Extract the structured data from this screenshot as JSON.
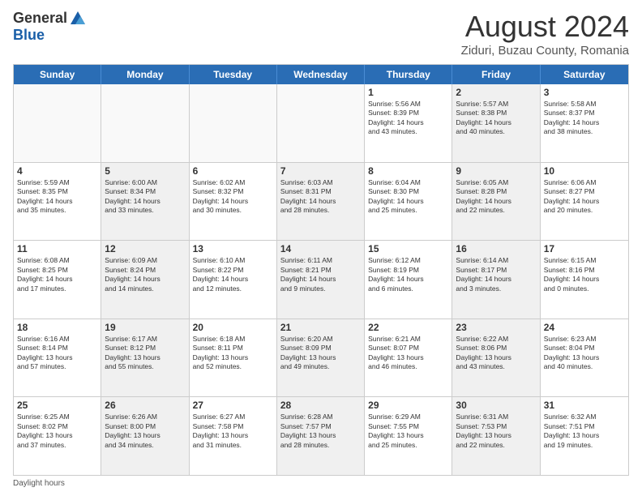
{
  "header": {
    "logo_general": "General",
    "logo_blue": "Blue",
    "month_year": "August 2024",
    "location": "Ziduri, Buzau County, Romania"
  },
  "days_of_week": [
    "Sunday",
    "Monday",
    "Tuesday",
    "Wednesday",
    "Thursday",
    "Friday",
    "Saturday"
  ],
  "weeks": [
    [
      {
        "num": "",
        "info": "",
        "shaded": false,
        "empty": true
      },
      {
        "num": "",
        "info": "",
        "shaded": false,
        "empty": true
      },
      {
        "num": "",
        "info": "",
        "shaded": false,
        "empty": true
      },
      {
        "num": "",
        "info": "",
        "shaded": false,
        "empty": true
      },
      {
        "num": "1",
        "info": "Sunrise: 5:56 AM\nSunset: 8:39 PM\nDaylight: 14 hours\nand 43 minutes.",
        "shaded": false,
        "empty": false
      },
      {
        "num": "2",
        "info": "Sunrise: 5:57 AM\nSunset: 8:38 PM\nDaylight: 14 hours\nand 40 minutes.",
        "shaded": true,
        "empty": false
      },
      {
        "num": "3",
        "info": "Sunrise: 5:58 AM\nSunset: 8:37 PM\nDaylight: 14 hours\nand 38 minutes.",
        "shaded": false,
        "empty": false
      }
    ],
    [
      {
        "num": "4",
        "info": "Sunrise: 5:59 AM\nSunset: 8:35 PM\nDaylight: 14 hours\nand 35 minutes.",
        "shaded": false,
        "empty": false
      },
      {
        "num": "5",
        "info": "Sunrise: 6:00 AM\nSunset: 8:34 PM\nDaylight: 14 hours\nand 33 minutes.",
        "shaded": true,
        "empty": false
      },
      {
        "num": "6",
        "info": "Sunrise: 6:02 AM\nSunset: 8:32 PM\nDaylight: 14 hours\nand 30 minutes.",
        "shaded": false,
        "empty": false
      },
      {
        "num": "7",
        "info": "Sunrise: 6:03 AM\nSunset: 8:31 PM\nDaylight: 14 hours\nand 28 minutes.",
        "shaded": true,
        "empty": false
      },
      {
        "num": "8",
        "info": "Sunrise: 6:04 AM\nSunset: 8:30 PM\nDaylight: 14 hours\nand 25 minutes.",
        "shaded": false,
        "empty": false
      },
      {
        "num": "9",
        "info": "Sunrise: 6:05 AM\nSunset: 8:28 PM\nDaylight: 14 hours\nand 22 minutes.",
        "shaded": true,
        "empty": false
      },
      {
        "num": "10",
        "info": "Sunrise: 6:06 AM\nSunset: 8:27 PM\nDaylight: 14 hours\nand 20 minutes.",
        "shaded": false,
        "empty": false
      }
    ],
    [
      {
        "num": "11",
        "info": "Sunrise: 6:08 AM\nSunset: 8:25 PM\nDaylight: 14 hours\nand 17 minutes.",
        "shaded": false,
        "empty": false
      },
      {
        "num": "12",
        "info": "Sunrise: 6:09 AM\nSunset: 8:24 PM\nDaylight: 14 hours\nand 14 minutes.",
        "shaded": true,
        "empty": false
      },
      {
        "num": "13",
        "info": "Sunrise: 6:10 AM\nSunset: 8:22 PM\nDaylight: 14 hours\nand 12 minutes.",
        "shaded": false,
        "empty": false
      },
      {
        "num": "14",
        "info": "Sunrise: 6:11 AM\nSunset: 8:21 PM\nDaylight: 14 hours\nand 9 minutes.",
        "shaded": true,
        "empty": false
      },
      {
        "num": "15",
        "info": "Sunrise: 6:12 AM\nSunset: 8:19 PM\nDaylight: 14 hours\nand 6 minutes.",
        "shaded": false,
        "empty": false
      },
      {
        "num": "16",
        "info": "Sunrise: 6:14 AM\nSunset: 8:17 PM\nDaylight: 14 hours\nand 3 minutes.",
        "shaded": true,
        "empty": false
      },
      {
        "num": "17",
        "info": "Sunrise: 6:15 AM\nSunset: 8:16 PM\nDaylight: 14 hours\nand 0 minutes.",
        "shaded": false,
        "empty": false
      }
    ],
    [
      {
        "num": "18",
        "info": "Sunrise: 6:16 AM\nSunset: 8:14 PM\nDaylight: 13 hours\nand 57 minutes.",
        "shaded": false,
        "empty": false
      },
      {
        "num": "19",
        "info": "Sunrise: 6:17 AM\nSunset: 8:12 PM\nDaylight: 13 hours\nand 55 minutes.",
        "shaded": true,
        "empty": false
      },
      {
        "num": "20",
        "info": "Sunrise: 6:18 AM\nSunset: 8:11 PM\nDaylight: 13 hours\nand 52 minutes.",
        "shaded": false,
        "empty": false
      },
      {
        "num": "21",
        "info": "Sunrise: 6:20 AM\nSunset: 8:09 PM\nDaylight: 13 hours\nand 49 minutes.",
        "shaded": true,
        "empty": false
      },
      {
        "num": "22",
        "info": "Sunrise: 6:21 AM\nSunset: 8:07 PM\nDaylight: 13 hours\nand 46 minutes.",
        "shaded": false,
        "empty": false
      },
      {
        "num": "23",
        "info": "Sunrise: 6:22 AM\nSunset: 8:06 PM\nDaylight: 13 hours\nand 43 minutes.",
        "shaded": true,
        "empty": false
      },
      {
        "num": "24",
        "info": "Sunrise: 6:23 AM\nSunset: 8:04 PM\nDaylight: 13 hours\nand 40 minutes.",
        "shaded": false,
        "empty": false
      }
    ],
    [
      {
        "num": "25",
        "info": "Sunrise: 6:25 AM\nSunset: 8:02 PM\nDaylight: 13 hours\nand 37 minutes.",
        "shaded": false,
        "empty": false
      },
      {
        "num": "26",
        "info": "Sunrise: 6:26 AM\nSunset: 8:00 PM\nDaylight: 13 hours\nand 34 minutes.",
        "shaded": true,
        "empty": false
      },
      {
        "num": "27",
        "info": "Sunrise: 6:27 AM\nSunset: 7:58 PM\nDaylight: 13 hours\nand 31 minutes.",
        "shaded": false,
        "empty": false
      },
      {
        "num": "28",
        "info": "Sunrise: 6:28 AM\nSunset: 7:57 PM\nDaylight: 13 hours\nand 28 minutes.",
        "shaded": true,
        "empty": false
      },
      {
        "num": "29",
        "info": "Sunrise: 6:29 AM\nSunset: 7:55 PM\nDaylight: 13 hours\nand 25 minutes.",
        "shaded": false,
        "empty": false
      },
      {
        "num": "30",
        "info": "Sunrise: 6:31 AM\nSunset: 7:53 PM\nDaylight: 13 hours\nand 22 minutes.",
        "shaded": true,
        "empty": false
      },
      {
        "num": "31",
        "info": "Sunrise: 6:32 AM\nSunset: 7:51 PM\nDaylight: 13 hours\nand 19 minutes.",
        "shaded": false,
        "empty": false
      }
    ]
  ],
  "footer": {
    "daylight_label": "Daylight hours"
  }
}
